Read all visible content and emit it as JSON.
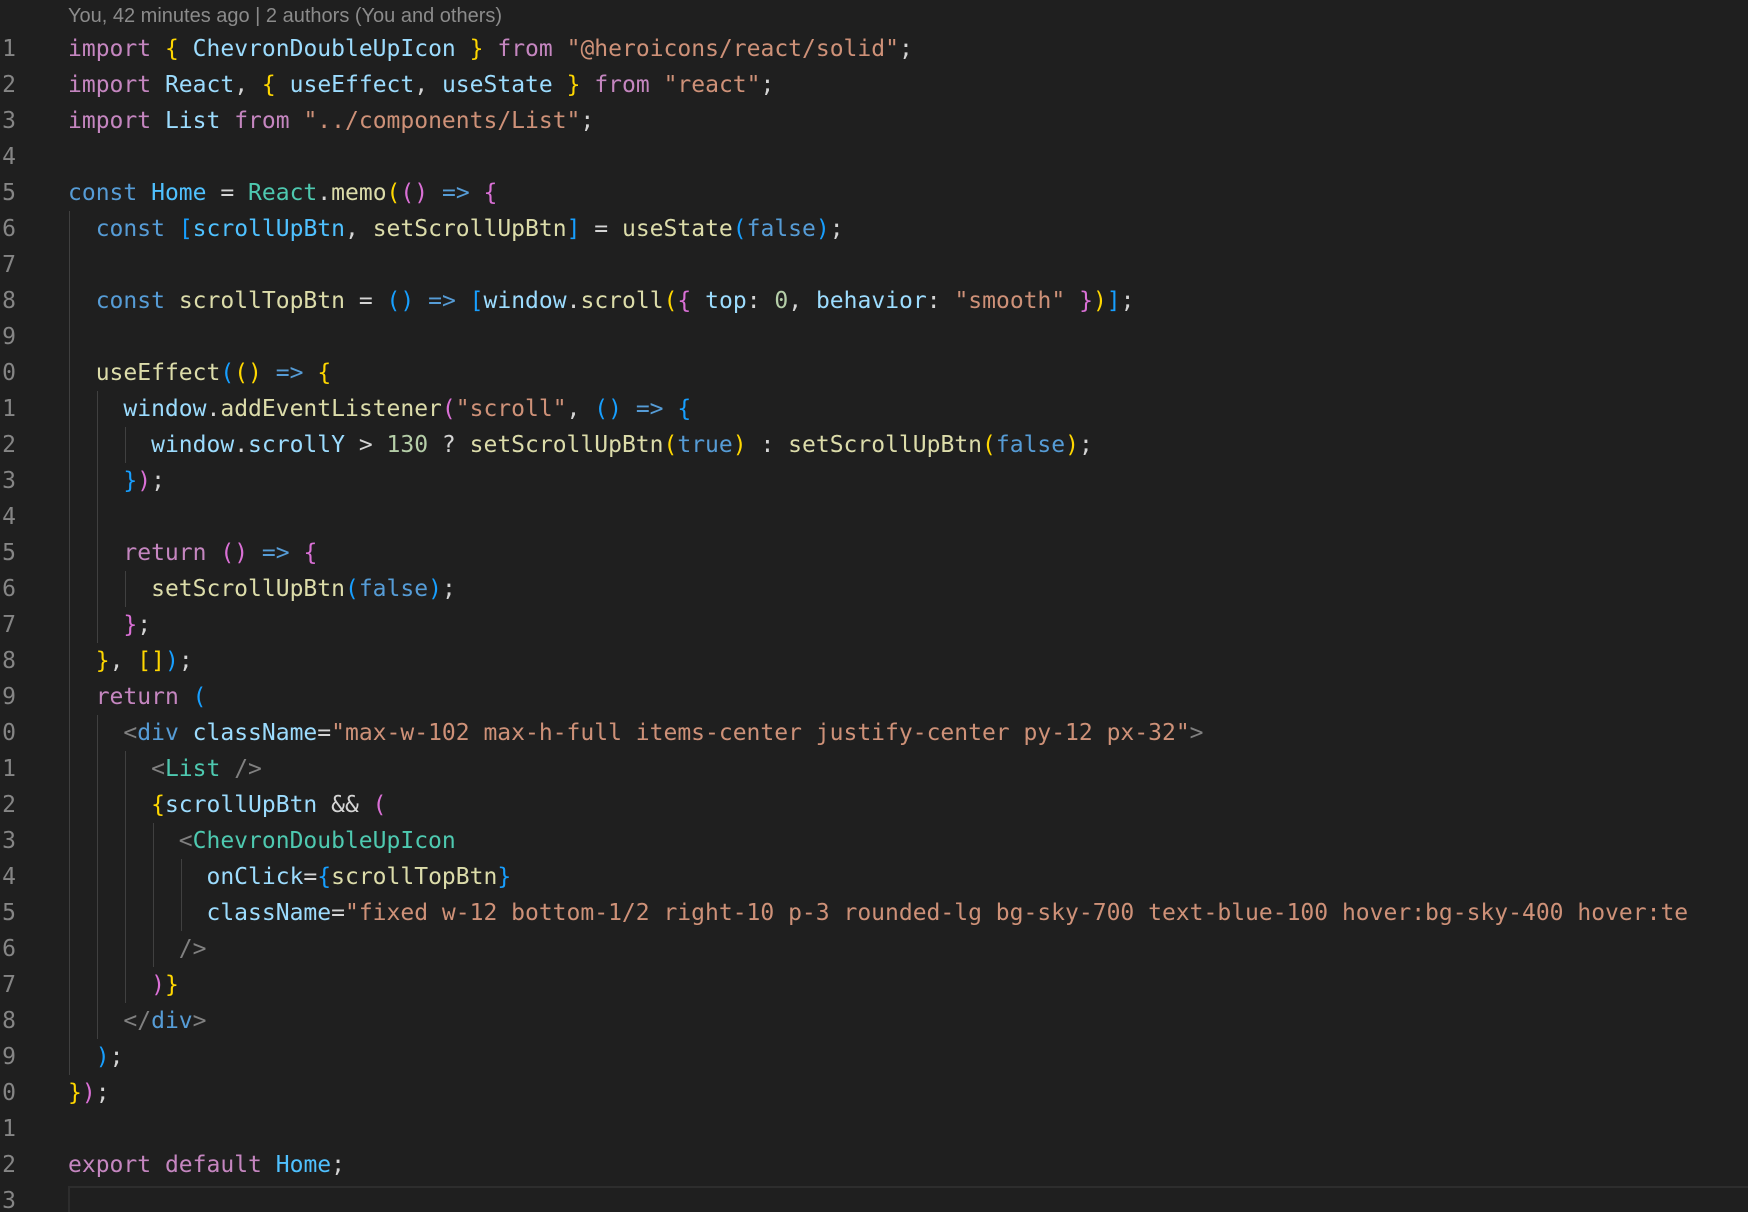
{
  "editor": {
    "blame_annotation": "You, 42 minutes ago | 2 authors (You and others)",
    "line_numbers": [
      "1",
      "2",
      "3",
      "4",
      "5",
      "6",
      "7",
      "8",
      "9",
      "0",
      "1",
      "2",
      "3",
      "4",
      "5",
      "6",
      "7",
      "8",
      "9",
      "0",
      "1",
      "2",
      "3",
      "4",
      "5",
      "6",
      "7",
      "8",
      "9",
      "0",
      "1",
      "2",
      "3"
    ],
    "colors": {
      "background": "#1f1f1f",
      "keyword": "#c586c0",
      "storage": "#569cd6",
      "function": "#dcdcaa",
      "variable": "#9cdcfe",
      "constant": "#4fc1ff",
      "string": "#ce9178",
      "number": "#b5cea8",
      "type": "#4ec9b0",
      "bracket_level_1": "#ffd700",
      "bracket_level_2": "#da70d6",
      "bracket_level_3": "#179fff"
    },
    "lines": [
      [
        [
          "kw",
          "import"
        ],
        [
          "pl",
          " "
        ],
        [
          "b1",
          "{"
        ],
        [
          "pl",
          " "
        ],
        [
          "va",
          "ChevronDoubleUpIcon"
        ],
        [
          "pl",
          " "
        ],
        [
          "b1",
          "}"
        ],
        [
          "pl",
          " "
        ],
        [
          "kw",
          "from"
        ],
        [
          "pl",
          " "
        ],
        [
          "str",
          "\"@heroicons/react/solid\""
        ],
        [
          "pl",
          ";"
        ]
      ],
      [
        [
          "kw",
          "import"
        ],
        [
          "pl",
          " "
        ],
        [
          "va",
          "React"
        ],
        [
          "pl",
          ", "
        ],
        [
          "b1",
          "{"
        ],
        [
          "pl",
          " "
        ],
        [
          "va",
          "useEffect"
        ],
        [
          "pl",
          ", "
        ],
        [
          "va",
          "useState"
        ],
        [
          "pl",
          " "
        ],
        [
          "b1",
          "}"
        ],
        [
          "pl",
          " "
        ],
        [
          "kw",
          "from"
        ],
        [
          "pl",
          " "
        ],
        [
          "str",
          "\"react\""
        ],
        [
          "pl",
          ";"
        ]
      ],
      [
        [
          "kw",
          "import"
        ],
        [
          "pl",
          " "
        ],
        [
          "va",
          "List"
        ],
        [
          "pl",
          " "
        ],
        [
          "kw",
          "from"
        ],
        [
          "pl",
          " "
        ],
        [
          "str",
          "\"../components/List\""
        ],
        [
          "pl",
          ";"
        ]
      ],
      [],
      [
        [
          "st",
          "const"
        ],
        [
          "pl",
          " "
        ],
        [
          "cv",
          "Home"
        ],
        [
          "pl",
          " = "
        ],
        [
          "ty",
          "React"
        ],
        [
          "pl",
          "."
        ],
        [
          "fn",
          "memo"
        ],
        [
          "b1",
          "("
        ],
        [
          "b2",
          "()"
        ],
        [
          "pl",
          " "
        ],
        [
          "st",
          "=>"
        ],
        [
          "pl",
          " "
        ],
        [
          "b2",
          "{"
        ]
      ],
      [
        [
          "pl",
          "  "
        ],
        [
          "st",
          "const"
        ],
        [
          "pl",
          " "
        ],
        [
          "b3",
          "["
        ],
        [
          "cv",
          "scrollUpBtn"
        ],
        [
          "pl",
          ", "
        ],
        [
          "fn",
          "setScrollUpBtn"
        ],
        [
          "b3",
          "]"
        ],
        [
          "pl",
          " = "
        ],
        [
          "fn",
          "useState"
        ],
        [
          "b3",
          "("
        ],
        [
          "st",
          "false"
        ],
        [
          "b3",
          ")"
        ],
        [
          "pl",
          ";"
        ]
      ],
      [],
      [
        [
          "pl",
          "  "
        ],
        [
          "st",
          "const"
        ],
        [
          "pl",
          " "
        ],
        [
          "fn",
          "scrollTopBtn"
        ],
        [
          "pl",
          " = "
        ],
        [
          "b3",
          "()"
        ],
        [
          "pl",
          " "
        ],
        [
          "st",
          "=>"
        ],
        [
          "pl",
          " "
        ],
        [
          "b3",
          "["
        ],
        [
          "va",
          "window"
        ],
        [
          "pl",
          "."
        ],
        [
          "fn",
          "scroll"
        ],
        [
          "b1",
          "("
        ],
        [
          "b2",
          "{"
        ],
        [
          "pl",
          " "
        ],
        [
          "va",
          "top"
        ],
        [
          "pl",
          ": "
        ],
        [
          "num",
          "0"
        ],
        [
          "pl",
          ", "
        ],
        [
          "va",
          "behavior"
        ],
        [
          "pl",
          ": "
        ],
        [
          "str",
          "\"smooth\""
        ],
        [
          "pl",
          " "
        ],
        [
          "b2",
          "}"
        ],
        [
          "b1",
          ")"
        ],
        [
          "b3",
          "]"
        ],
        [
          "pl",
          ";"
        ]
      ],
      [],
      [
        [
          "pl",
          "  "
        ],
        [
          "fn",
          "useEffect"
        ],
        [
          "b3",
          "("
        ],
        [
          "b1",
          "()"
        ],
        [
          "pl",
          " "
        ],
        [
          "st",
          "=>"
        ],
        [
          "pl",
          " "
        ],
        [
          "b1",
          "{"
        ]
      ],
      [
        [
          "pl",
          "    "
        ],
        [
          "va",
          "window"
        ],
        [
          "pl",
          "."
        ],
        [
          "fn",
          "addEventListener"
        ],
        [
          "b2",
          "("
        ],
        [
          "str",
          "\"scroll\""
        ],
        [
          "pl",
          ", "
        ],
        [
          "b3",
          "()"
        ],
        [
          "pl",
          " "
        ],
        [
          "st",
          "=>"
        ],
        [
          "pl",
          " "
        ],
        [
          "b3",
          "{"
        ]
      ],
      [
        [
          "pl",
          "      "
        ],
        [
          "va",
          "window"
        ],
        [
          "pl",
          "."
        ],
        [
          "va",
          "scrollY"
        ],
        [
          "pl",
          " > "
        ],
        [
          "num",
          "130"
        ],
        [
          "pl",
          " ? "
        ],
        [
          "fn",
          "setScrollUpBtn"
        ],
        [
          "b1",
          "("
        ],
        [
          "st",
          "true"
        ],
        [
          "b1",
          ")"
        ],
        [
          "pl",
          " : "
        ],
        [
          "fn",
          "setScrollUpBtn"
        ],
        [
          "b1",
          "("
        ],
        [
          "st",
          "false"
        ],
        [
          "b1",
          ")"
        ],
        [
          "pl",
          ";"
        ]
      ],
      [
        [
          "pl",
          "    "
        ],
        [
          "b3",
          "}"
        ],
        [
          "b2",
          ")"
        ],
        [
          "pl",
          ";"
        ]
      ],
      [],
      [
        [
          "pl",
          "    "
        ],
        [
          "kw",
          "return"
        ],
        [
          "pl",
          " "
        ],
        [
          "b2",
          "()"
        ],
        [
          "pl",
          " "
        ],
        [
          "st",
          "=>"
        ],
        [
          "pl",
          " "
        ],
        [
          "b2",
          "{"
        ]
      ],
      [
        [
          "pl",
          "      "
        ],
        [
          "fn",
          "setScrollUpBtn"
        ],
        [
          "b3",
          "("
        ],
        [
          "st",
          "false"
        ],
        [
          "b3",
          ")"
        ],
        [
          "pl",
          ";"
        ]
      ],
      [
        [
          "pl",
          "    "
        ],
        [
          "b2",
          "}"
        ],
        [
          "pl",
          ";"
        ]
      ],
      [
        [
          "pl",
          "  "
        ],
        [
          "b1",
          "}"
        ],
        [
          "pl",
          ", "
        ],
        [
          "b1",
          "[]"
        ],
        [
          "b3",
          ")"
        ],
        [
          "pl",
          ";"
        ]
      ],
      [
        [
          "pl",
          "  "
        ],
        [
          "kw",
          "return"
        ],
        [
          "pl",
          " "
        ],
        [
          "b3",
          "("
        ]
      ],
      [
        [
          "pl",
          "    "
        ],
        [
          "ang",
          "<"
        ],
        [
          "tag",
          "div"
        ],
        [
          "pl",
          " "
        ],
        [
          "va",
          "className"
        ],
        [
          "pl",
          "="
        ],
        [
          "str",
          "\"max-w-102 max-h-full items-center justify-center py-12 px-32\""
        ],
        [
          "ang",
          ">"
        ]
      ],
      [
        [
          "pl",
          "      "
        ],
        [
          "ang",
          "<"
        ],
        [
          "ty",
          "List"
        ],
        [
          "pl",
          " "
        ],
        [
          "ang",
          "/>"
        ]
      ],
      [
        [
          "pl",
          "      "
        ],
        [
          "b1",
          "{"
        ],
        [
          "va",
          "scrollUpBtn"
        ],
        [
          "pl",
          " && "
        ],
        [
          "b2",
          "("
        ]
      ],
      [
        [
          "pl",
          "        "
        ],
        [
          "ang",
          "<"
        ],
        [
          "ty",
          "ChevronDoubleUpIcon"
        ]
      ],
      [
        [
          "pl",
          "          "
        ],
        [
          "va",
          "onClick"
        ],
        [
          "pl",
          "="
        ],
        [
          "b3",
          "{"
        ],
        [
          "fn",
          "scrollTopBtn"
        ],
        [
          "b3",
          "}"
        ]
      ],
      [
        [
          "pl",
          "          "
        ],
        [
          "va",
          "className"
        ],
        [
          "pl",
          "="
        ],
        [
          "str",
          "\"fixed w-12 bottom-1/2 right-10 p-3 rounded-lg bg-sky-700 text-blue-100 hover:bg-sky-400 hover:te"
        ]
      ],
      [
        [
          "pl",
          "        "
        ],
        [
          "ang",
          "/>"
        ]
      ],
      [
        [
          "pl",
          "      "
        ],
        [
          "b2",
          ")"
        ],
        [
          "b1",
          "}"
        ]
      ],
      [
        [
          "pl",
          "    "
        ],
        [
          "ang",
          "</"
        ],
        [
          "tag",
          "div"
        ],
        [
          "ang",
          ">"
        ]
      ],
      [
        [
          "pl",
          "  "
        ],
        [
          "b3",
          ")"
        ],
        [
          "pl",
          ";"
        ]
      ],
      [
        [
          "b1",
          "}"
        ],
        [
          "b2",
          ")"
        ],
        [
          "pl",
          ";"
        ]
      ],
      [],
      [
        [
          "kw",
          "export"
        ],
        [
          "pl",
          " "
        ],
        [
          "kw",
          "default"
        ],
        [
          "pl",
          " "
        ],
        [
          "cv",
          "Home"
        ],
        [
          "pl",
          ";"
        ]
      ],
      []
    ]
  }
}
